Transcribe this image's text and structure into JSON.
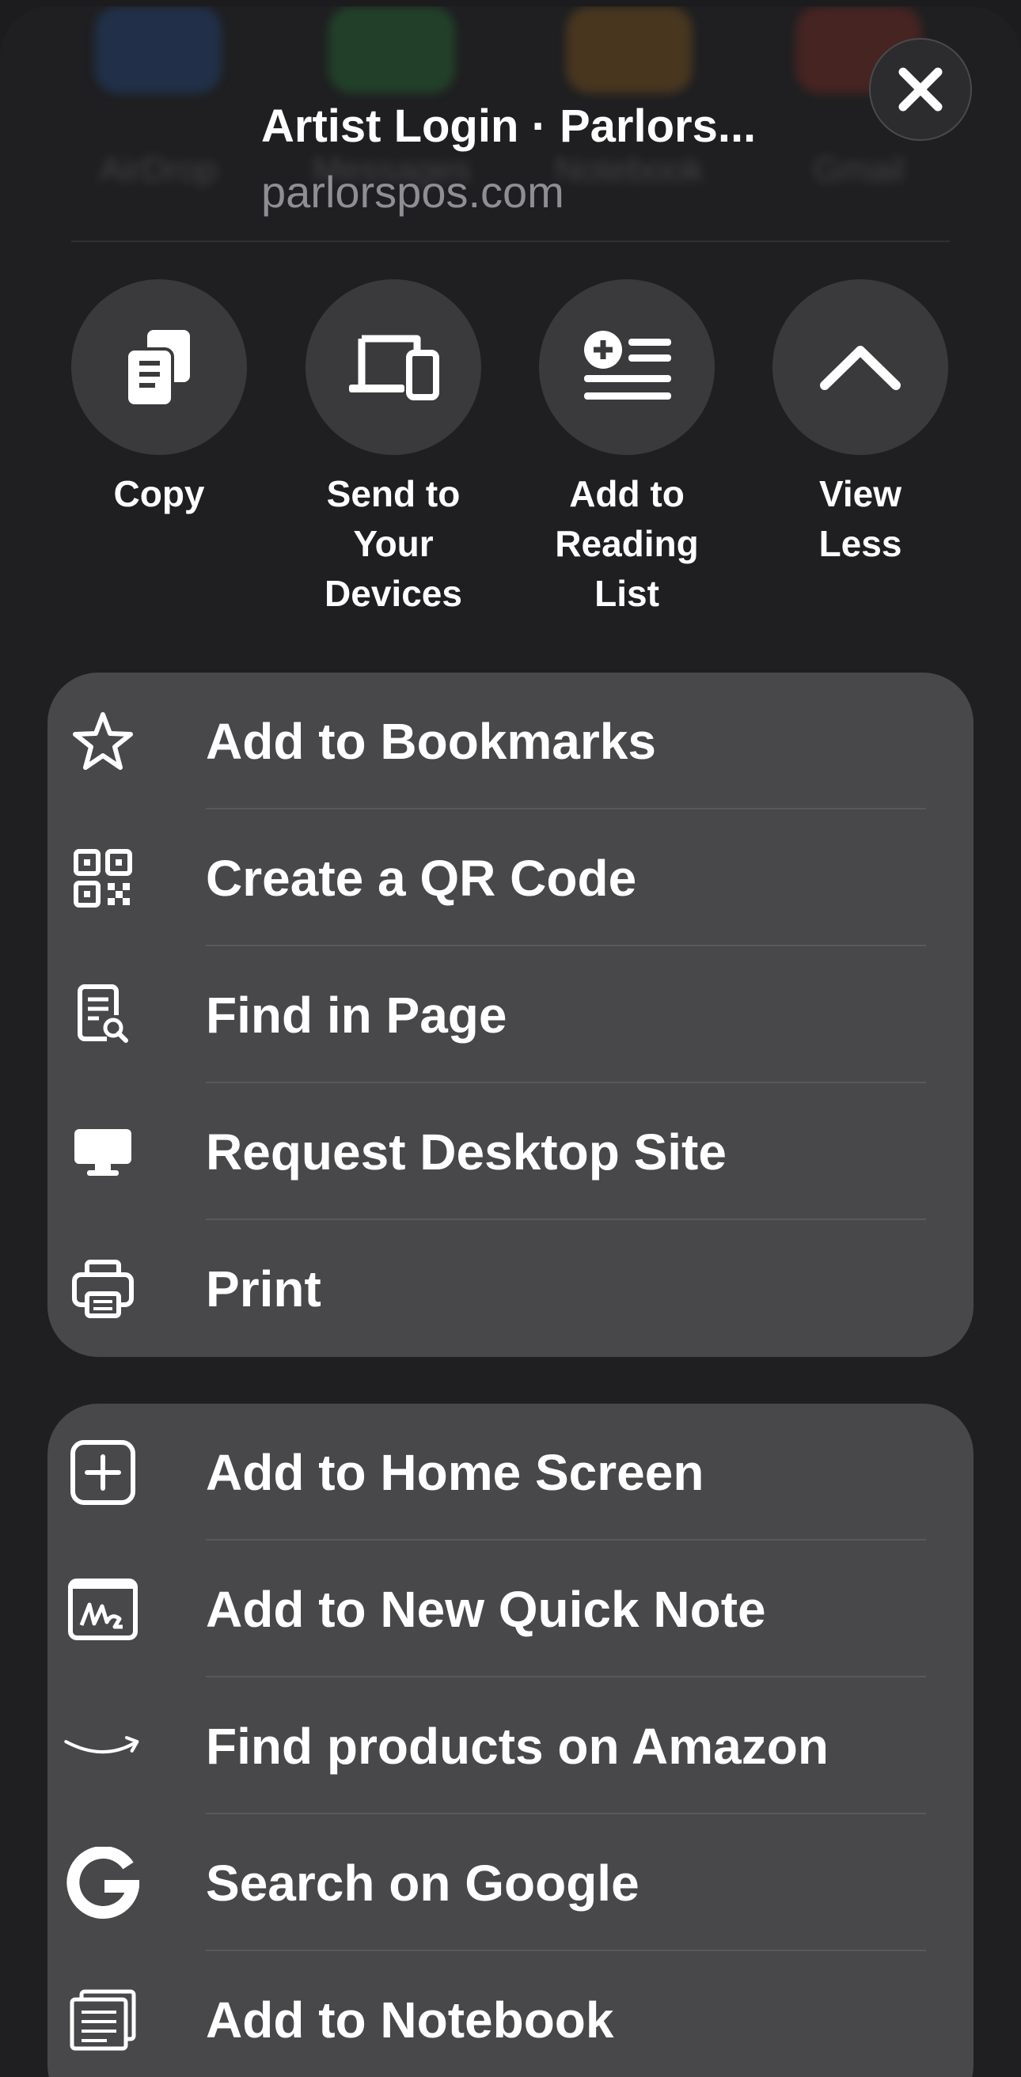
{
  "share_sheet": {
    "ghost_apps": [
      "AirDrop",
      "Messages",
      "Notebook",
      "Gmail"
    ],
    "title": "Artist Login · Parlors...",
    "url": "parlorspos.com",
    "close_icon": "xmark-icon"
  },
  "quick_actions": [
    {
      "label": "Copy",
      "icon": "copy-icon"
    },
    {
      "label": "Send to Your Devices",
      "icon": "devices-icon"
    },
    {
      "label": "Add to Reading List",
      "icon": "reading-list-icon"
    },
    {
      "label": "View Less",
      "icon": "chevron-up-icon"
    }
  ],
  "group1": [
    {
      "label": "Add to Bookmarks",
      "icon": "star-icon"
    },
    {
      "label": "Create a QR Code",
      "icon": "qr-code-icon"
    },
    {
      "label": "Find in Page",
      "icon": "find-in-page-icon"
    },
    {
      "label": "Request Desktop Site",
      "icon": "desktop-icon"
    },
    {
      "label": "Print",
      "icon": "printer-icon"
    }
  ],
  "group2": [
    {
      "label": "Add to Home Screen",
      "icon": "plus-square-icon"
    },
    {
      "label": "Add to New Quick Note",
      "icon": "quick-note-icon"
    },
    {
      "label": "Find products on Amazon",
      "icon": "amazon-icon"
    },
    {
      "label": "Search on Google",
      "icon": "google-icon"
    },
    {
      "label": "Add to Notebook",
      "icon": "notebook-icon"
    }
  ]
}
